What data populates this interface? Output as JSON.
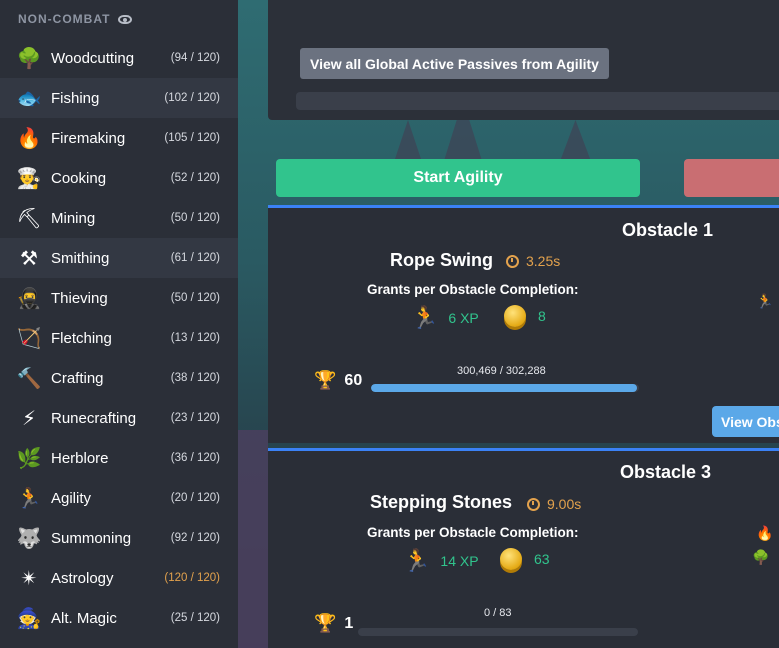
{
  "sidebar": {
    "header": "NON-COMBAT",
    "items": [
      {
        "name": "Woodcutting",
        "level": "(94 / 120)",
        "icon": "🌳"
      },
      {
        "name": "Fishing",
        "level": "(102 / 120)",
        "icon": "🐟"
      },
      {
        "name": "Firemaking",
        "level": "(105 / 120)",
        "icon": "🔥"
      },
      {
        "name": "Cooking",
        "level": "(52 / 120)",
        "icon": "👨‍🍳"
      },
      {
        "name": "Mining",
        "level": "(50 / 120)",
        "icon": "⛏"
      },
      {
        "name": "Smithing",
        "level": "(61 / 120)",
        "icon": "⚒"
      },
      {
        "name": "Thieving",
        "level": "(50 / 120)",
        "icon": "🥷"
      },
      {
        "name": "Fletching",
        "level": "(13 / 120)",
        "icon": "🏹"
      },
      {
        "name": "Crafting",
        "level": "(38 / 120)",
        "icon": "🔨"
      },
      {
        "name": "Runecrafting",
        "level": "(23 / 120)",
        "icon": "⚡"
      },
      {
        "name": "Herblore",
        "level": "(36 / 120)",
        "icon": "🌿"
      },
      {
        "name": "Agility",
        "level": "(20 / 120)",
        "icon": "🏃"
      },
      {
        "name": "Summoning",
        "level": "(92 / 120)",
        "icon": "🐺"
      },
      {
        "name": "Astrology",
        "level": "(120 / 120)",
        "icon": "✴"
      },
      {
        "name": "Alt. Magic",
        "level": "(25 / 120)",
        "icon": "🧙"
      }
    ]
  },
  "top": {
    "view_passives_label": "View all Global Active Passives from Agility"
  },
  "controls": {
    "start_label": "Start Agility"
  },
  "obstacles": [
    {
      "title": "Obstacle 1",
      "name": "Rope Swing",
      "time": "3.25s",
      "grants_label": "Grants per Obstacle Completion:",
      "xp": "6 XP",
      "gp": "8",
      "mastery_level": "60",
      "mastery_progress": "300,469 / 302,288",
      "mastery_fraction": 0.994,
      "view_button": "View Obstacle"
    },
    {
      "title": "Obstacle 3",
      "name": "Stepping Stones",
      "time": "9.00s",
      "grants_label": "Grants per Obstacle Completion:",
      "xp": "14 XP",
      "gp": "63",
      "mastery_level": "1",
      "mastery_progress": "0 / 83",
      "mastery_fraction": 0.0
    }
  ],
  "colors": {
    "accent_blue": "#3b82f6",
    "start_green": "#31c48d",
    "max_level_orange": "#e3a24d"
  }
}
